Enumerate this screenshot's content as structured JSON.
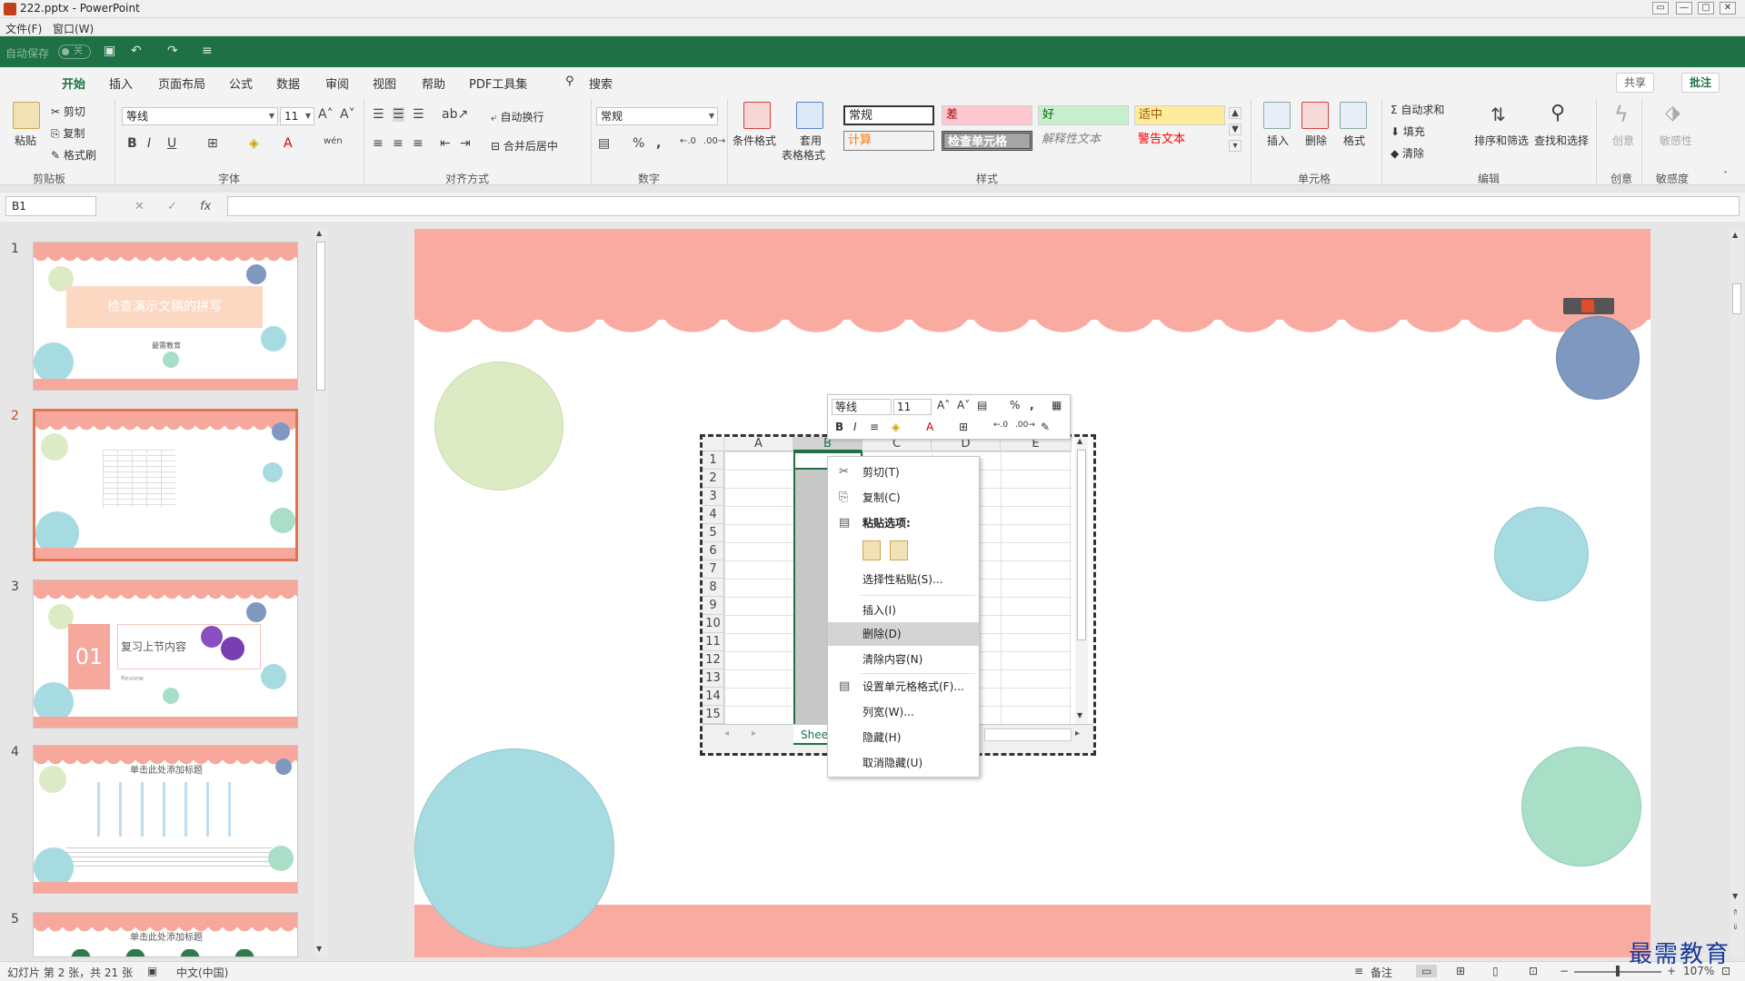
{
  "window": {
    "title": "222.pptx - PowerPoint",
    "controls": [
      "—",
      "▢",
      "✕",
      "▭"
    ]
  },
  "menubar": {
    "items": [
      "文件(F)",
      "窗口(W)"
    ]
  },
  "qat": {
    "autosave_label": "自动保存",
    "autosave_state": "关"
  },
  "ribbon_tabs": {
    "tabs": [
      "开始",
      "插入",
      "页面布局",
      "公式",
      "数据",
      "审阅",
      "视图",
      "帮助",
      "PDF工具集"
    ],
    "search": "搜索",
    "share": "共享",
    "comments": "批注"
  },
  "ribbon": {
    "clipboard": {
      "paste": "粘贴",
      "cut": "剪切",
      "copy": "复制",
      "format_painter": "格式刷",
      "group": "剪贴板"
    },
    "font": {
      "name": "等线",
      "size": "11",
      "group": "字体"
    },
    "alignment": {
      "wrap": "自动换行",
      "merge": "合并后居中",
      "group": "对齐方式"
    },
    "number": {
      "format": "常规",
      "group": "数字"
    },
    "styles": {
      "cond_format": "条件格式",
      "table_format_1": "套用",
      "table_format_2": "表格格式",
      "cells": [
        "常规",
        "差",
        "好",
        "适中",
        "计算",
        "检查单元格",
        "解释性文本",
        "警告文本"
      ],
      "group": "样式"
    },
    "cells_grp": {
      "insert": "插入",
      "delete": "删除",
      "format": "格式",
      "group": "单元格"
    },
    "editing": {
      "autosum": "自动求和",
      "fill": "填充",
      "clear": "清除",
      "sort": "排序和筛选",
      "find": "查找和选择",
      "group": "编辑"
    },
    "creative": {
      "btn": "创意",
      "group": "创意"
    },
    "sensitivity": {
      "btn": "敏感性",
      "group": "敏感度"
    }
  },
  "formula_bar": {
    "namebox": "B1",
    "fx": "fx"
  },
  "slides": {
    "numbers": [
      "1",
      "2",
      "3",
      "4",
      "5"
    ],
    "s1_title": "检查演示文稿的拼写",
    "s1_sub": "最需教育",
    "s3_num": "01",
    "s3_title": "复习上节内容",
    "s3_sub": "Review",
    "s4_title": "单击此处添加标题",
    "s5_title": "单击此处添加标题"
  },
  "excel": {
    "columns": [
      "A",
      "B",
      "C",
      "D",
      "E"
    ],
    "rows": [
      "1",
      "2",
      "3",
      "4",
      "5",
      "6",
      "7",
      "8",
      "9",
      "10",
      "11",
      "12",
      "13",
      "14",
      "15"
    ],
    "sheet_tab": "Shee"
  },
  "mini_toolbar": {
    "font": "等线",
    "size": "11"
  },
  "context_menu": {
    "cut": "剪切(T)",
    "copy": "复制(C)",
    "paste_options": "粘贴选项:",
    "paste_special": "选择性粘贴(S)...",
    "insert": "插入(I)",
    "delete": "删除(D)",
    "clear": "清除内容(N)",
    "format_cells": "设置单元格格式(F)...",
    "col_width": "列宽(W)...",
    "hide": "隐藏(H)",
    "unhide": "取消隐藏(U)"
  },
  "status": {
    "slide_info": "幻灯片 第 2 张，共 21 张",
    "language": "中文(中国)",
    "notes": "备注",
    "zoom": "107%"
  },
  "watermark": "最需教育",
  "colors": {
    "accent": "#1e7145",
    "scallop": "#f9aba2",
    "selected_slide": "#e2744f"
  }
}
